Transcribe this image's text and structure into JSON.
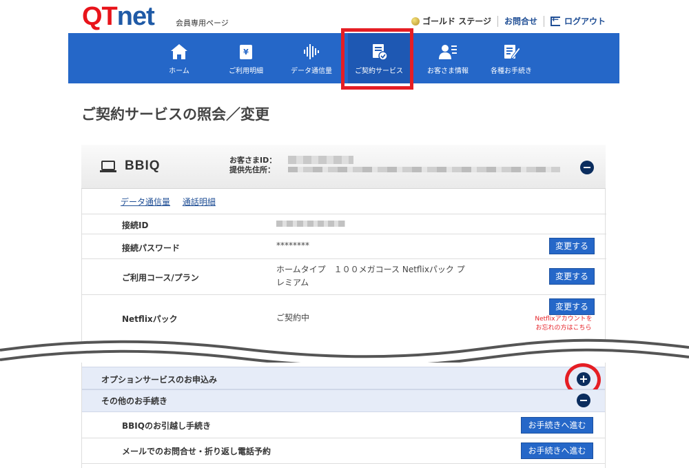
{
  "header": {
    "logo_q": "QT",
    "logo_net": "net",
    "member_page": "会員専用ページ",
    "stage": "ゴールド ステージ",
    "contact": "お問合せ",
    "logout": "ログアウト"
  },
  "nav": {
    "items": [
      {
        "label": "ホーム",
        "icon": "home-icon"
      },
      {
        "label": "ご利用明細",
        "icon": "invoice-icon"
      },
      {
        "label": "データ通信量",
        "icon": "waveform-icon"
      },
      {
        "label": "ご契約サービス",
        "icon": "contract-icon"
      },
      {
        "label": "お客さま情報",
        "icon": "user-info-icon"
      },
      {
        "label": "各種お手続き",
        "icon": "procedure-icon"
      }
    ],
    "active_index": 3
  },
  "page": {
    "title": "ご契約サービスの照会／変更"
  },
  "service": {
    "name": "BBIQ",
    "customer_id_label": "お客さまID：",
    "address_label": "提供先住所：",
    "sublinks": [
      "データ通信量",
      "通話明細"
    ],
    "rows": [
      {
        "key": "接続ID",
        "value": ""
      },
      {
        "key": "接続パスワード",
        "value": "********",
        "button": "変更する"
      },
      {
        "key": "ご利用コース/プラン",
        "value_line1": "ホームタイプ　１００メガコース Netflixパック プ",
        "value_line2": "レミアム",
        "button": "変更する"
      },
      {
        "key": "Netflixパック",
        "value": "ご契約中",
        "button": "変更する",
        "note_line1": "Netflixアカウントを",
        "note_line2": "お忘れの方はこちら"
      }
    ]
  },
  "options": {
    "apply_label": "オプションサービスのお申込み",
    "other_label": "その他のお手続き",
    "procedures": [
      {
        "label": "BBIQのお引越し手続き",
        "button": "お手続きへ進む"
      },
      {
        "label": "メールでのお問合せ・折り返し電話予約",
        "button": "お手続きへ進む"
      }
    ]
  },
  "colors": {
    "nav_blue": "#2567c8",
    "highlight_red": "#e51e24",
    "toggle_navy": "#0b2d5e"
  }
}
